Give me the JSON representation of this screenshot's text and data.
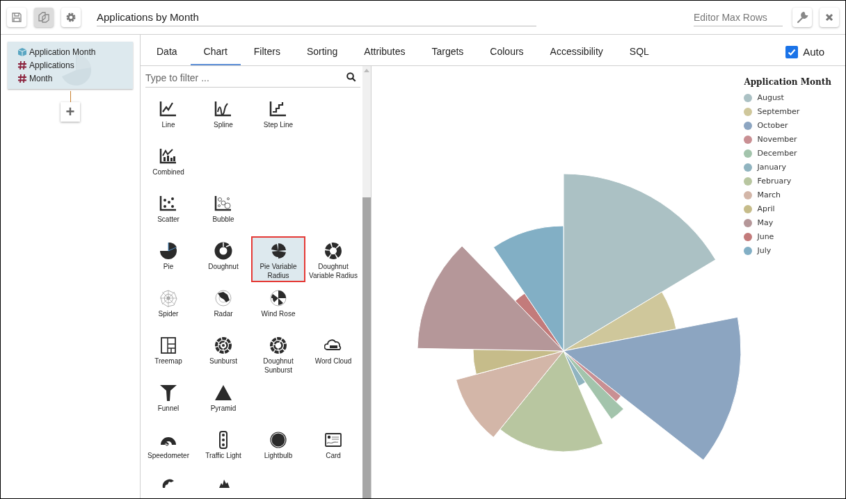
{
  "toolbar": {
    "title_value": "Applications by Month",
    "max_rows_placeholder": "Editor Max Rows"
  },
  "tree": {
    "items": [
      {
        "kind": "dimension",
        "label": "Application Month"
      },
      {
        "kind": "measure",
        "label": "Applications"
      },
      {
        "kind": "measure",
        "label": "Month"
      }
    ],
    "add_button": "+"
  },
  "tabs": [
    {
      "label": "Data",
      "selected": false
    },
    {
      "label": "Chart",
      "selected": true
    },
    {
      "label": "Filters",
      "selected": false
    },
    {
      "label": "Sorting",
      "selected": false
    },
    {
      "label": "Attributes",
      "selected": false
    },
    {
      "label": "Targets",
      "selected": false
    },
    {
      "label": "Colours",
      "selected": false
    },
    {
      "label": "Accessibility",
      "selected": false
    },
    {
      "label": "SQL",
      "selected": false
    }
  ],
  "auto": {
    "label": "Auto",
    "checked": true
  },
  "catalog": {
    "filter_placeholder": "Type to filter ...",
    "rows": [
      {
        "items": [
          {
            "label": "Line",
            "selected": false
          },
          {
            "label": "Spline",
            "selected": false
          },
          {
            "label": "Step Line",
            "selected": false
          }
        ]
      },
      {
        "items": [
          {
            "label": "Combined",
            "selected": false
          }
        ]
      },
      {
        "items": [
          {
            "label": "Scatter",
            "selected": false
          },
          {
            "label": "Bubble",
            "selected": false
          }
        ]
      },
      {
        "items": [
          {
            "label": "Pie",
            "selected": false
          },
          {
            "label": "Doughnut",
            "selected": false
          },
          {
            "label": "Pie Variable Radius",
            "selected": true
          },
          {
            "label": "Doughnut Variable Radius",
            "selected": false
          }
        ]
      },
      {
        "items": [
          {
            "label": "Spider",
            "selected": false
          },
          {
            "label": "Radar",
            "selected": false
          },
          {
            "label": "Wind Rose",
            "selected": false
          }
        ]
      },
      {
        "items": [
          {
            "label": "Treemap",
            "selected": false
          },
          {
            "label": "Sunburst",
            "selected": false
          },
          {
            "label": "Doughnut Sunburst",
            "selected": false
          },
          {
            "label": "Word Cloud",
            "selected": false
          }
        ]
      },
      {
        "items": [
          {
            "label": "Funnel",
            "selected": false
          },
          {
            "label": "Pyramid",
            "selected": false
          }
        ]
      },
      {
        "items": [
          {
            "label": "Speedometer",
            "selected": false
          },
          {
            "label": "Traffic Light",
            "selected": false
          },
          {
            "label": "Lightbulb",
            "selected": false
          },
          {
            "label": "Card",
            "selected": false
          }
        ]
      }
    ]
  },
  "legend": {
    "title": "Application Month",
    "items": [
      {
        "label": "August",
        "color": "#abc1c4"
      },
      {
        "label": "September",
        "color": "#cfc79b"
      },
      {
        "label": "October",
        "color": "#8ca5c1"
      },
      {
        "label": "November",
        "color": "#c98f93"
      },
      {
        "label": "December",
        "color": "#a3c4ac"
      },
      {
        "label": "January",
        "color": "#90b4c0"
      },
      {
        "label": "February",
        "color": "#b8c6a0"
      },
      {
        "label": "March",
        "color": "#d3b6a8"
      },
      {
        "label": "April",
        "color": "#c6bc8a"
      },
      {
        "label": "May",
        "color": "#b59799"
      },
      {
        "label": "June",
        "color": "#c37b7b"
      },
      {
        "label": "July",
        "color": "#82afc5"
      }
    ]
  }
}
